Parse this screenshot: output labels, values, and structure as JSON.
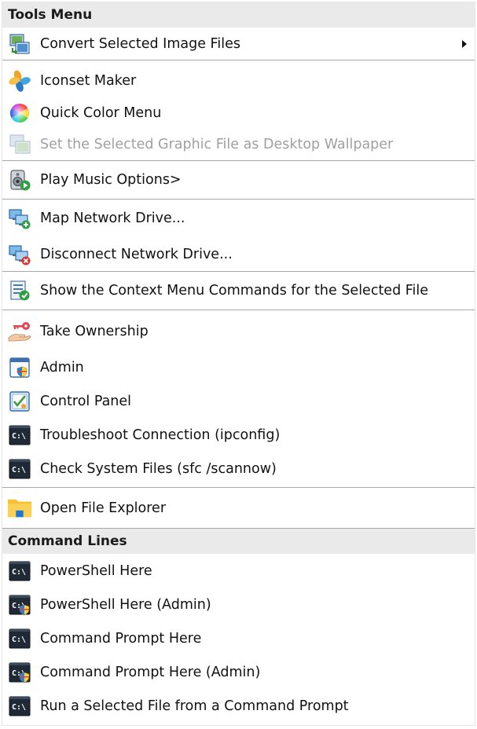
{
  "tools_menu": {
    "title": "Tools Menu",
    "convert": "Convert Selected Image Files",
    "iconset": "Iconset Maker",
    "quick_color": "Quick Color Menu",
    "wallpaper": "Set the Selected Graphic File as Desktop Wallpaper",
    "play_music": "Play Music Options>",
    "map_drive": "Map Network Drive...",
    "disconnect_drive": "Disconnect Network Drive...",
    "context_menu": "Show the Context Menu Commands for the Selected File",
    "ownership": "Take Ownership",
    "admin": "Admin",
    "control_panel": "Control Panel",
    "troubleshoot": "Troubleshoot Connection (ipconfig)",
    "check_files": "Check System Files (sfc /scannow)",
    "file_explorer": "Open File Explorer"
  },
  "command_lines": {
    "title": "Command Lines",
    "ps_here": "PowerShell Here",
    "ps_admin": "PowerShell Here (Admin)",
    "cmd_here": "Command Prompt Here",
    "cmd_admin": "Command Prompt Here (Admin)",
    "run_file": "Run a Selected File from a Command Prompt"
  },
  "icons": {
    "convert": "image-convert-icon",
    "iconset": "iconset-maker-icon",
    "quick_color": "color-wheel-icon",
    "wallpaper": "wallpaper-icon",
    "play_music": "speaker-play-icon",
    "map_drive": "network-drive-add-icon",
    "disconnect_drive": "network-drive-remove-icon",
    "context_menu": "context-menu-check-icon",
    "ownership": "key-hand-icon",
    "admin": "admin-window-icon",
    "control_panel": "control-panel-icon",
    "terminal": "terminal-icon",
    "terminal_admin": "terminal-admin-icon",
    "folder": "folder-icon"
  },
  "colors": {
    "header_bg": "#eaeaea",
    "separator": "#a8a8a8",
    "disabled_text": "#a0a0a0",
    "terminal_bg": "#1f2a36",
    "folder_yellow": "#f7c136",
    "folder_blue": "#1e78d2"
  }
}
